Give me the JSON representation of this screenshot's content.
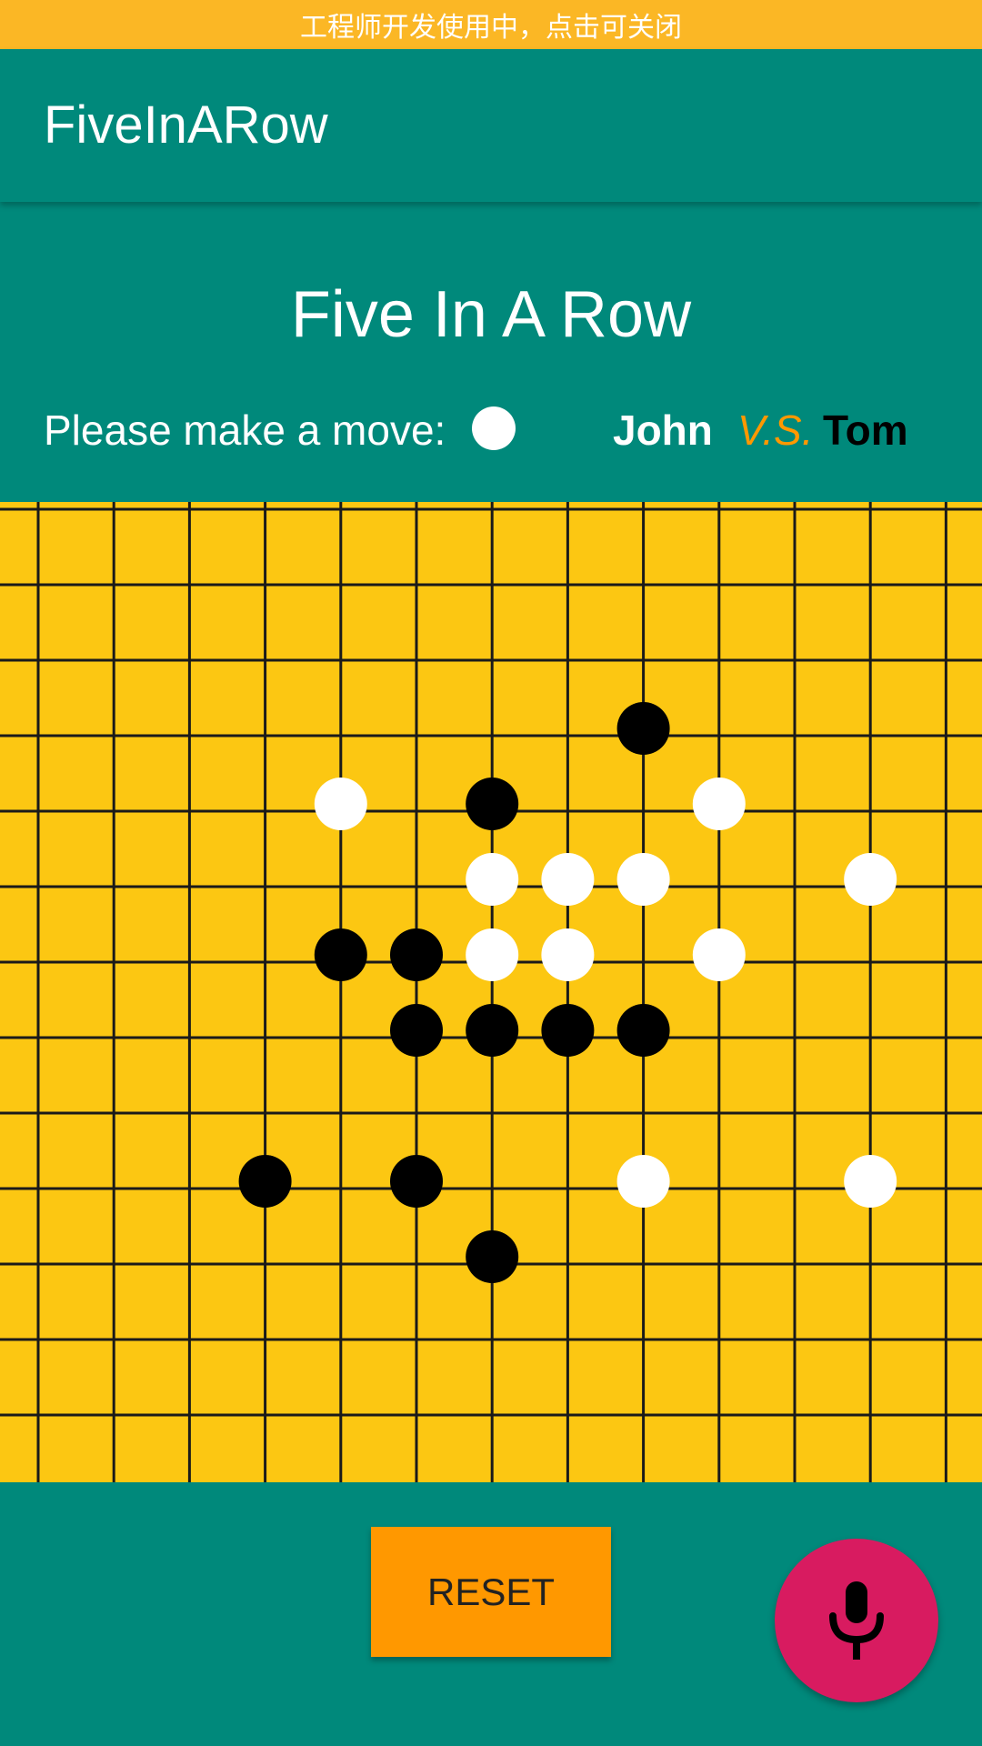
{
  "banner": {
    "text": "工程师开发使用中，点击可关闭"
  },
  "appbar": {
    "title": "FiveInARow"
  },
  "game": {
    "title": "Five In A Row",
    "prompt": "Please make a move:",
    "current_turn": "white",
    "player1": "John",
    "vs": "V.S.",
    "player2": "Tom"
  },
  "board": {
    "rows": 13,
    "cols": 13,
    "stones": [
      {
        "col": 8,
        "row": 2,
        "color": "black"
      },
      {
        "col": 4,
        "row": 3,
        "color": "white"
      },
      {
        "col": 6,
        "row": 3,
        "color": "black"
      },
      {
        "col": 9,
        "row": 3,
        "color": "white"
      },
      {
        "col": 6,
        "row": 4,
        "color": "white"
      },
      {
        "col": 7,
        "row": 4,
        "color": "white"
      },
      {
        "col": 8,
        "row": 4,
        "color": "white"
      },
      {
        "col": 11,
        "row": 4,
        "color": "white"
      },
      {
        "col": 4,
        "row": 5,
        "color": "black"
      },
      {
        "col": 5,
        "row": 5,
        "color": "black"
      },
      {
        "col": 6,
        "row": 5,
        "color": "white"
      },
      {
        "col": 7,
        "row": 5,
        "color": "white"
      },
      {
        "col": 9,
        "row": 5,
        "color": "white"
      },
      {
        "col": 5,
        "row": 6,
        "color": "black"
      },
      {
        "col": 6,
        "row": 6,
        "color": "black"
      },
      {
        "col": 7,
        "row": 6,
        "color": "black"
      },
      {
        "col": 8,
        "row": 6,
        "color": "black"
      },
      {
        "col": 3,
        "row": 8,
        "color": "black"
      },
      {
        "col": 5,
        "row": 8,
        "color": "black"
      },
      {
        "col": 8,
        "row": 8,
        "color": "white"
      },
      {
        "col": 11,
        "row": 8,
        "color": "white"
      },
      {
        "col": 6,
        "row": 9,
        "color": "black"
      }
    ]
  },
  "controls": {
    "reset_label": "RESET",
    "mic_icon": "microphone-icon"
  },
  "colors": {
    "primary": "#00897B",
    "banner": "#FBB725",
    "board": "#FCC712",
    "accent": "#FF9800",
    "fab": "#D81B60"
  }
}
